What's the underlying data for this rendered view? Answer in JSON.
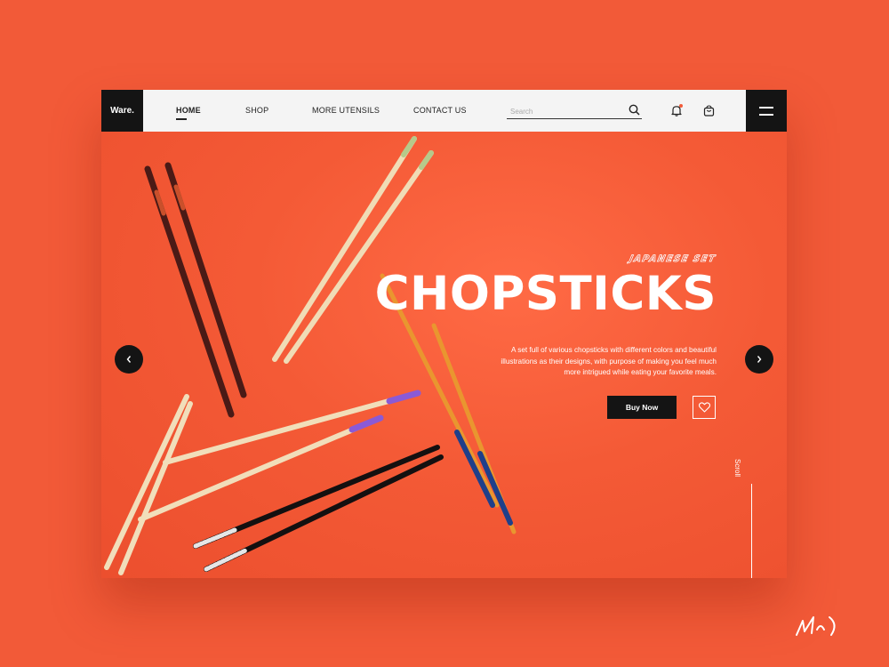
{
  "brand": {
    "logo": "Ware."
  },
  "nav": {
    "links": [
      {
        "label": "HOME",
        "active": true
      },
      {
        "label": "SHOP",
        "active": false
      },
      {
        "label": "MORE UTENSILS",
        "active": false
      },
      {
        "label": "CONTACT US",
        "active": false
      }
    ],
    "search_placeholder": "Search",
    "icons": [
      "search-icon",
      "bell-icon",
      "cart-icon",
      "menu-icon"
    ]
  },
  "hero": {
    "tagline": "JAPANESE SET",
    "title": "CHOPSTICKS",
    "description": "A set full of various chopsticks with different colors and beautiful illustrations as their designs, with purpose of making you feel much more intrigued while eating your favorite meals.",
    "buy_label": "Buy Now",
    "scroll_label": "Scroll"
  },
  "colors": {
    "accent": "#f25a38",
    "dark": "#141414",
    "navbar": "#f4f4f4"
  }
}
